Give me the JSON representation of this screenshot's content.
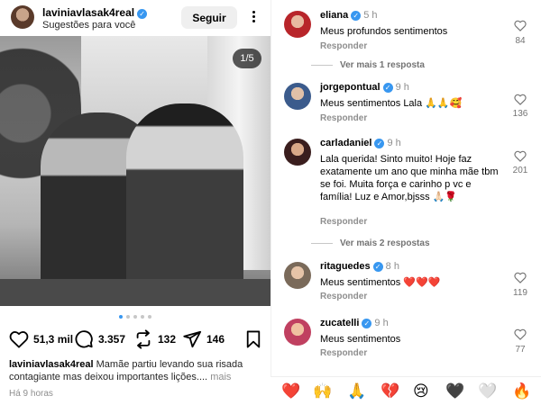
{
  "post": {
    "username": "laviniavlasak4real",
    "subtitle": "Sugestões para você",
    "follow_label": "Seguir",
    "photo_counter": "1/5",
    "carousel_dots": 5,
    "carousel_active": 0,
    "likes": "51,3 mil",
    "comments": "3.357",
    "reposts": "132",
    "shares": "146",
    "caption_user": "laviniavlasak4real",
    "caption_text": "Mamãe partiu levando sua risada contagiante mas deixou importantes lições....",
    "caption_more": "mais",
    "time": "Há 9 horas"
  },
  "comments": [
    {
      "user": "eliana",
      "time": "5 h",
      "text": "Meus profundos sentimentos",
      "reply": "Responder",
      "likes": "84",
      "verified": true,
      "avatar_color": "#b8252a"
    },
    {
      "view_more": "Ver mais 1 resposta"
    },
    {
      "user": "jorgepontual",
      "time": "9 h",
      "text": "Meus sentimentos  Lala 🙏🙏🥰",
      "reply": "Responder",
      "likes": "136",
      "verified": true,
      "avatar_color": "#3b5b8c"
    },
    {
      "user": "carladaniel",
      "time": "9 h",
      "text": "Lala querida! Sinto muito! Hoje faz exatamente um ano que minha mãe tbm se foi. Muita força e carinho p vc e família! Luz e Amor,bjsss 🙏🏻🌹",
      "reply": "Responder",
      "likes": "201",
      "verified": true,
      "avatar_color": "#5a2a2a"
    },
    {
      "view_more": "Ver mais 2 respostas"
    },
    {
      "user": "ritaguedes",
      "time": "8 h",
      "text": "Meus sentimentos ❤️❤️❤️",
      "reply": "Responder",
      "likes": "119",
      "verified": true,
      "avatar_color": "#7a6a5a"
    },
    {
      "user": "zucatelli",
      "time": "9 h",
      "text": "Meus sentimentos",
      "reply": "Responder",
      "likes": "77",
      "verified": true,
      "avatar_color": "#c04060"
    }
  ],
  "emoji_bar": [
    "❤️",
    "🙌",
    "🙏",
    "💔",
    "😢",
    "🖤",
    "🤍",
    "🔥"
  ],
  "colors": {
    "verified": "#3897f0",
    "heart_red": "#ed4956",
    "muted": "#8e8e8e"
  }
}
